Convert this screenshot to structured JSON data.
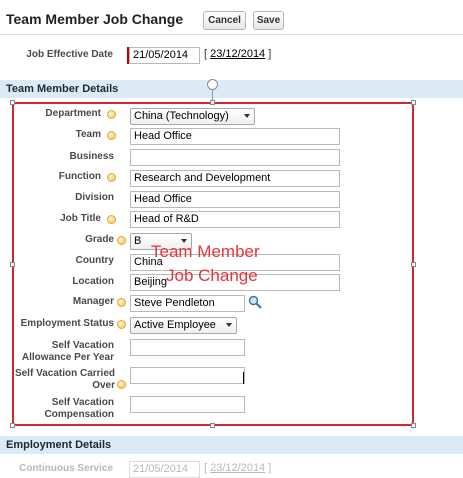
{
  "header": {
    "title": "Team Member Job Change",
    "cancel_label": "Cancel",
    "save_label": "Save"
  },
  "effective_date": {
    "label": "Job Effective Date",
    "value": "21/05/2014",
    "link": "23/12/2014"
  },
  "sections": {
    "team_member_details": "Team Member Details",
    "employment_details": "Employment Details"
  },
  "fields": {
    "department": {
      "label": "Department",
      "value": "China (Technology)"
    },
    "team": {
      "label": "Team",
      "value": "Head Office"
    },
    "business": {
      "label": "Business",
      "value": ""
    },
    "function": {
      "label": "Function",
      "value": "Research and Development"
    },
    "division": {
      "label": "Division",
      "value": "Head Office"
    },
    "job_title": {
      "label": "Job Title",
      "value": "Head of R&D"
    },
    "grade": {
      "label": "Grade",
      "value": "B"
    },
    "country": {
      "label": "Country",
      "value": "China"
    },
    "location": {
      "label": "Location",
      "value": "Beijing"
    },
    "manager": {
      "label": "Manager",
      "value": "Steve Pendleton"
    },
    "employment_status": {
      "label": "Employment Status",
      "value": "Active Employee"
    },
    "self_vacation_allowance": {
      "label": "Self Vacation Allowance Per Year",
      "value": ""
    },
    "self_vacation_carried_over": {
      "label": "Self Vacation Carried Over",
      "value": ""
    },
    "self_vacation_compensation": {
      "label": "Self Vacation Compensation",
      "value": ""
    }
  },
  "annotation": {
    "line1": "Team Member",
    "line2": "Job Change"
  },
  "continuous_service": {
    "label": "Continuous Service",
    "value": "21/05/2014",
    "link": "23/12/2014"
  },
  "colors": {
    "section_bg": "#dbeaf4",
    "highlight_border": "#d0262e",
    "annotation_text": "#e8343b",
    "required_bar": "#c00000"
  }
}
